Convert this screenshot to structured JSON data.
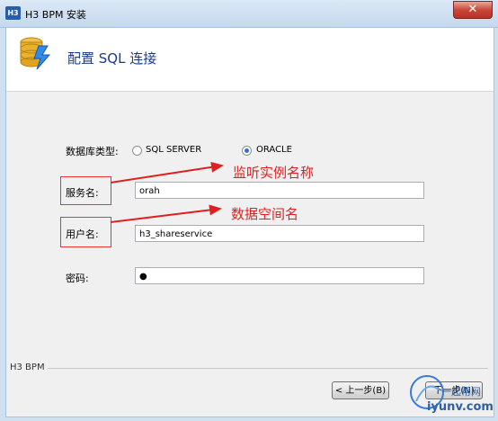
{
  "window": {
    "title": "H3 BPM 安装",
    "app_icon_text": "H3",
    "close_glyph": "✕"
  },
  "header": {
    "title": "配置 SQL 连接"
  },
  "form": {
    "db_type_label": "数据库类型:",
    "db_options": [
      {
        "label": "SQL SERVER",
        "selected": false
      },
      {
        "label": "ORACLE",
        "selected": true
      }
    ],
    "service_label": "服务名:",
    "service_value": "orah",
    "user_label": "用户名:",
    "user_value": "h3_shareservice",
    "password_label": "密码:",
    "password_value": "●"
  },
  "annotations": {
    "service_note": "监听实例名称",
    "user_note": "数据空间名",
    "color": "#e02020"
  },
  "footer": {
    "brand": "H3 BPM",
    "back_button": "< 上一步(B)",
    "next_button": "下一步(N)",
    "watermark_top": "一起帮网",
    "watermark_bottom": "iyunv.com"
  }
}
